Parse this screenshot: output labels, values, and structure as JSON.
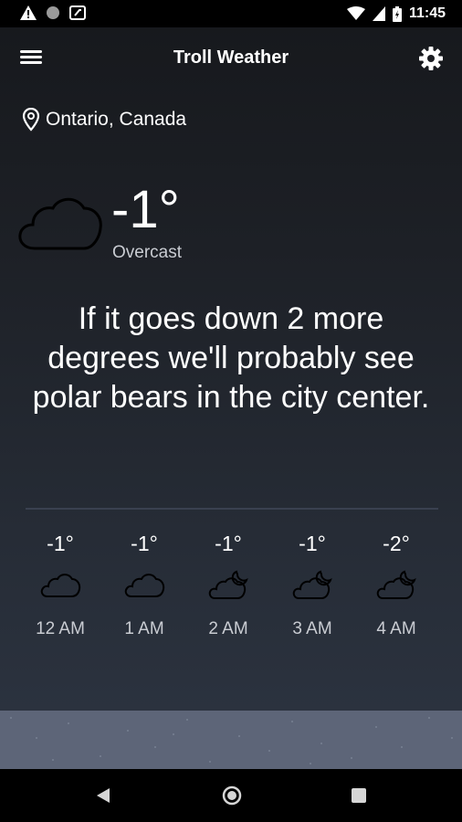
{
  "status_bar": {
    "time": "11:45"
  },
  "app_bar": {
    "title": "Troll Weather"
  },
  "location": {
    "label": "Ontario, Canada"
  },
  "current": {
    "temperature": "-1°",
    "condition": "Overcast",
    "icon": "cloud-icon"
  },
  "quote": "If it goes down 2 more degrees we'll probably see polar bears in the city center.",
  "hourly": [
    {
      "temp": "-1°",
      "time": "12 AM",
      "icon": "cloud-icon"
    },
    {
      "temp": "-1°",
      "time": "1 AM",
      "icon": "cloud-icon"
    },
    {
      "temp": "-1°",
      "time": "2 AM",
      "icon": "cloud-moon-icon"
    },
    {
      "temp": "-1°",
      "time": "3 AM",
      "icon": "cloud-moon-icon"
    },
    {
      "temp": "-2°",
      "time": "4 AM",
      "icon": "cloud-moon-icon"
    }
  ]
}
